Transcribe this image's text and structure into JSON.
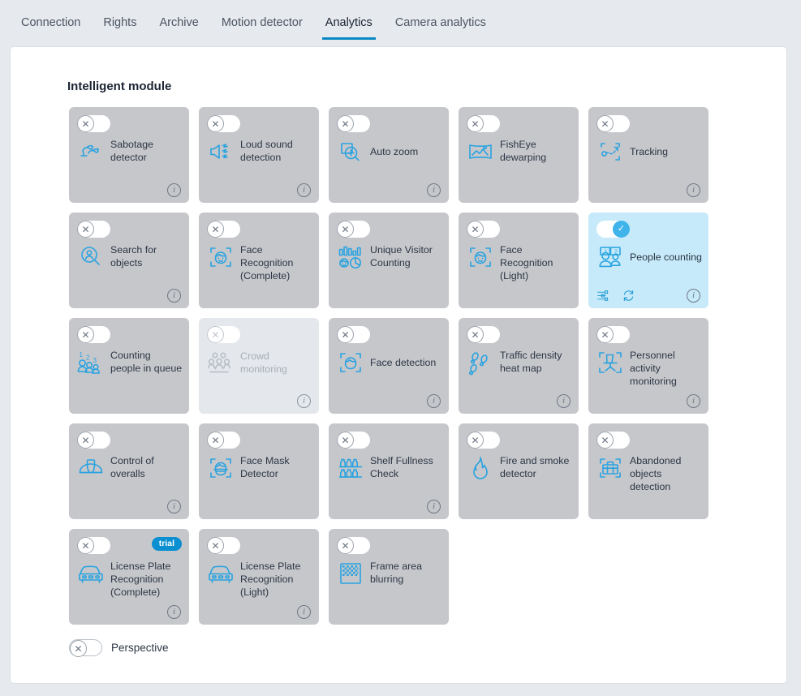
{
  "tabs": [
    {
      "label": "Connection",
      "active": false
    },
    {
      "label": "Rights",
      "active": false
    },
    {
      "label": "Archive",
      "active": false
    },
    {
      "label": "Motion detector",
      "active": false
    },
    {
      "label": "Analytics",
      "active": true
    },
    {
      "label": "Camera analytics",
      "active": false
    }
  ],
  "section": {
    "title": "Intelligent module"
  },
  "colors": {
    "page_background": "#e6e9ee",
    "panel_background": "#ffffff",
    "card_background": "#c6c7cb",
    "card_active_background": "#c6eaf9",
    "card_disabled_background": "#e4e7ec",
    "accent": "#0a88c4",
    "icon_blue": "#29a3e0",
    "toggle_on": "#3fb3ea",
    "badge_blue": "#0a8fd0"
  },
  "toggle_glyphs": {
    "off": "✕",
    "on": "✓"
  },
  "modules": [
    {
      "label": "Sabotage detector",
      "icon": "sabotage-detector-icon",
      "state": "off",
      "info": true,
      "settings": false,
      "refresh": false,
      "badge": null
    },
    {
      "label": "Loud sound detection",
      "icon": "loud-sound-icon",
      "state": "off",
      "info": true,
      "settings": false,
      "refresh": false,
      "badge": null
    },
    {
      "label": "Auto zoom",
      "icon": "auto-zoom-icon",
      "state": "off",
      "info": true,
      "settings": false,
      "refresh": false,
      "badge": null
    },
    {
      "label": "FishEye dewarping",
      "icon": "fisheye-dewarping-icon",
      "state": "off",
      "info": false,
      "settings": false,
      "refresh": false,
      "badge": null
    },
    {
      "label": "Tracking",
      "icon": "tracking-icon",
      "state": "off",
      "info": true,
      "settings": false,
      "refresh": false,
      "badge": null
    },
    {
      "label": "Search for objects",
      "icon": "search-objects-icon",
      "state": "off",
      "info": true,
      "settings": false,
      "refresh": false,
      "badge": null
    },
    {
      "label": "Face Recognition (Complete)",
      "icon": "face-recognition-icon",
      "state": "off",
      "info": false,
      "settings": false,
      "refresh": false,
      "badge": null
    },
    {
      "label": "Unique Visitor Counting",
      "icon": "unique-visitor-counting-icon",
      "state": "off",
      "info": false,
      "settings": false,
      "refresh": false,
      "badge": null
    },
    {
      "label": "Face Recognition (Light)",
      "icon": "face-recognition-icon",
      "state": "off",
      "info": false,
      "settings": false,
      "refresh": false,
      "badge": null
    },
    {
      "label": "People counting",
      "icon": "people-counting-icon",
      "state": "on",
      "info": true,
      "settings": true,
      "refresh": true,
      "badge": null
    },
    {
      "label": "Counting people in queue",
      "icon": "counting-people-queue-icon",
      "state": "off",
      "info": false,
      "settings": false,
      "refresh": false,
      "badge": null
    },
    {
      "label": "Crowd monitoring",
      "icon": "crowd-monitoring-icon",
      "state": "disabled",
      "info": true,
      "settings": false,
      "refresh": false,
      "badge": null
    },
    {
      "label": "Face detection",
      "icon": "face-detection-icon",
      "state": "off",
      "info": true,
      "settings": false,
      "refresh": false,
      "badge": null
    },
    {
      "label": "Traffic density heat map",
      "icon": "footprints-icon",
      "state": "off",
      "info": true,
      "settings": false,
      "refresh": false,
      "badge": null
    },
    {
      "label": "Personnel activity monitoring",
      "icon": "office-chair-icon",
      "state": "off",
      "info": true,
      "settings": false,
      "refresh": false,
      "badge": null
    },
    {
      "label": "Control of overalls",
      "icon": "hard-hat-icon",
      "state": "off",
      "info": true,
      "settings": false,
      "refresh": false,
      "badge": null
    },
    {
      "label": "Face Mask Detector",
      "icon": "face-mask-icon",
      "state": "off",
      "info": false,
      "settings": false,
      "refresh": false,
      "badge": null
    },
    {
      "label": "Shelf Fullness Check",
      "icon": "shelf-fullness-icon",
      "state": "off",
      "info": true,
      "settings": false,
      "refresh": false,
      "badge": null
    },
    {
      "label": "Fire and smoke detector",
      "icon": "flame-icon",
      "state": "off",
      "info": false,
      "settings": false,
      "refresh": false,
      "badge": null
    },
    {
      "label": "Abandoned objects detection",
      "icon": "abandoned-object-icon",
      "state": "off",
      "info": false,
      "settings": false,
      "refresh": false,
      "badge": null
    },
    {
      "label": "License Plate Recognition (Complete)",
      "icon": "car-plate-icon",
      "state": "off",
      "info": true,
      "settings": false,
      "refresh": false,
      "badge": "trial"
    },
    {
      "label": "License Plate Recognition (Light)",
      "icon": "car-plate-icon",
      "state": "off",
      "info": true,
      "settings": false,
      "refresh": false,
      "badge": null
    },
    {
      "label": "Frame area blurring",
      "icon": "frame-blur-icon",
      "state": "off",
      "info": false,
      "settings": false,
      "refresh": false,
      "badge": null
    }
  ],
  "perspective": {
    "label": "Perspective",
    "state": "off"
  }
}
